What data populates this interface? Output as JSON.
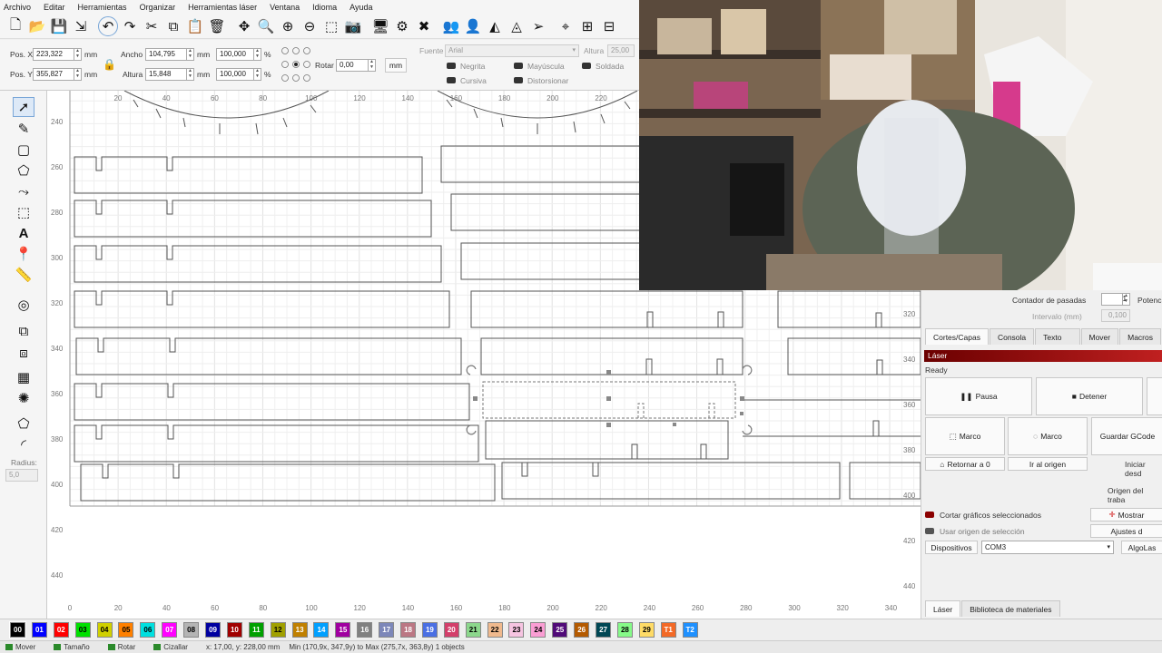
{
  "menu": [
    "Archivo",
    "Editar",
    "Herramientas",
    "Organizar",
    "Herramientas láser",
    "Ventana",
    "Idioma",
    "Ayuda"
  ],
  "props": {
    "pos_x_label": "Pos. X",
    "pos_x": "223,322",
    "pos_y_label": "Pos. Y",
    "pos_y": "355,827",
    "unit": "mm",
    "width_label": "Ancho",
    "width": "104,795",
    "height_label": "Altura",
    "height": "15,848",
    "scale_w": "100,000",
    "scale_h": "100,000",
    "pct": "%",
    "rotate_label": "Rotar",
    "rotate": "0,00",
    "mm_button": "mm",
    "font_label": "Fuente",
    "font_value": "Arial",
    "font_height_label": "Altura",
    "font_height": "25,00",
    "bold": "Negrita",
    "uppercase": "Mayúscula",
    "welded": "Soldada",
    "italic": "Cursiva",
    "distort": "Distorsionar"
  },
  "left": {
    "radius_label": "Radius:",
    "radius_value": "5,0"
  },
  "ruler": {
    "x": [
      "0",
      "20",
      "40",
      "60",
      "80",
      "100",
      "120",
      "140",
      "160",
      "180",
      "200",
      "220",
      "240",
      "260",
      "280",
      "300",
      "320",
      "340",
      "360"
    ],
    "x_top": [
      "20",
      "40",
      "60",
      "80",
      "100",
      "120",
      "140",
      "160",
      "180",
      "200",
      "220"
    ],
    "y": [
      "240",
      "260",
      "280",
      "300",
      "320",
      "340",
      "360",
      "380",
      "400",
      "420",
      "440"
    ],
    "y_right": [
      "320",
      "340",
      "360",
      "380",
      "400",
      "420",
      "440"
    ]
  },
  "right": {
    "pass_counter_label": "Contador de pasadas",
    "pass_counter": "1",
    "power_label": "Potenc",
    "interval_label": "Intervalo (mm)",
    "interval": "0,100",
    "tabs": [
      "Cortes/Capas",
      "Consola",
      "Texto variable",
      "Mover",
      "Macros"
    ],
    "laser_title": "Láser",
    "status": "Ready",
    "pause": "Pausa",
    "stop": "Detener",
    "frame1": "Marco",
    "frame2": "Marco",
    "save_gcode": "Guardar GCode",
    "return_zero": "Retornar a 0",
    "go_origin": "Ir al origen",
    "start_from": "Iniciar desd",
    "job_origin": "Origen del traba",
    "cut_selected": "Cortar gráficos seleccionados",
    "use_selection_origin": "Usar origen de selección",
    "show": "Mostrar",
    "settings": "Ajustes d",
    "devices": "Dispositivos",
    "port": "COM3",
    "algolaser": "AlgoLas",
    "bottom_tabs": [
      "Láser",
      "Biblioteca de materiales"
    ]
  },
  "palette": [
    {
      "label": "00",
      "color": "#000000"
    },
    {
      "label": "01",
      "color": "#0000ff"
    },
    {
      "label": "02",
      "color": "#ff0000"
    },
    {
      "label": "03",
      "color": "#00e000"
    },
    {
      "label": "04",
      "color": "#d0d000"
    },
    {
      "label": "05",
      "color": "#ff8000"
    },
    {
      "label": "06",
      "color": "#00e0e0"
    },
    {
      "label": "07",
      "color": "#ff00ff"
    },
    {
      "label": "08",
      "color": "#b4b4b4"
    },
    {
      "label": "09",
      "color": "#0000a0"
    },
    {
      "label": "10",
      "color": "#a00000"
    },
    {
      "label": "11",
      "color": "#00a000"
    },
    {
      "label": "12",
      "color": "#a0a000"
    },
    {
      "label": "13",
      "color": "#c08000"
    },
    {
      "label": "14",
      "color": "#00a0ff"
    },
    {
      "label": "15",
      "color": "#a000a0"
    },
    {
      "label": "16",
      "color": "#808080"
    },
    {
      "label": "17",
      "color": "#7d87b9"
    },
    {
      "label": "18",
      "color": "#bb7784"
    },
    {
      "label": "19",
      "color": "#4a6fe3"
    },
    {
      "label": "20",
      "color": "#d33f6a"
    },
    {
      "label": "21",
      "color": "#8cd78c"
    },
    {
      "label": "22",
      "color": "#f0b98d"
    },
    {
      "label": "23",
      "color": "#f6c4e1"
    },
    {
      "label": "24",
      "color": "#fa9ed4"
    },
    {
      "label": "25",
      "color": "#500a78"
    },
    {
      "label": "26",
      "color": "#b45a00"
    },
    {
      "label": "27",
      "color": "#004754"
    },
    {
      "label": "28",
      "color": "#86fa88"
    },
    {
      "label": "29",
      "color": "#ffdb66"
    },
    {
      "label": "T1",
      "color": "#f36926"
    },
    {
      "label": "T2",
      "color": "#1e90ff"
    }
  ],
  "status": {
    "move": "Mover",
    "size": "Tamaño",
    "rotate": "Rotar",
    "shear": "Cizallar",
    "coords": "x: 17,00, y: 228,00 mm",
    "bounds": "Min (170,9x, 347,9y) to Max (275,7x, 363,8y)  1 objects"
  }
}
